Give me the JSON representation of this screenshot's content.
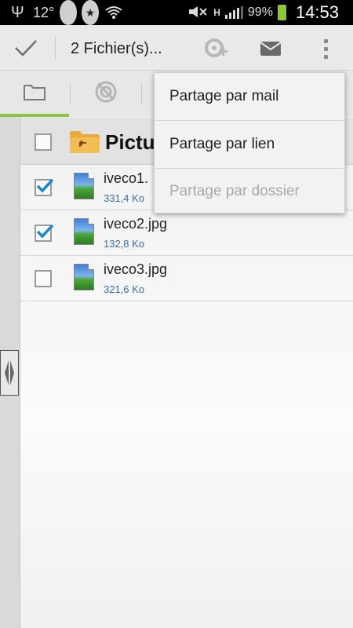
{
  "status_bar": {
    "temperature": "12°",
    "network_type": "H",
    "battery_percent": "99%",
    "time": "14:53"
  },
  "action_bar": {
    "title": "2 Fichier(s)..."
  },
  "folder": {
    "name": "Pictu"
  },
  "files": [
    {
      "name": "iveco1.",
      "size": "331,4 Ko",
      "checked": true
    },
    {
      "name": "iveco2.jpg",
      "size": "132,8 Ko",
      "checked": true
    },
    {
      "name": "iveco3.jpg",
      "size": "321,6 Ko",
      "checked": false
    }
  ],
  "menu": {
    "items": [
      {
        "label": "Partage par mail",
        "enabled": true
      },
      {
        "label": "Partage par lien",
        "enabled": true
      },
      {
        "label": "Partage par dossier",
        "enabled": false
      }
    ]
  },
  "colors": {
    "accent_green": "#8bc34a",
    "checkbox_blue": "#1e88c7",
    "size_text_blue": "#3b6ea5"
  }
}
